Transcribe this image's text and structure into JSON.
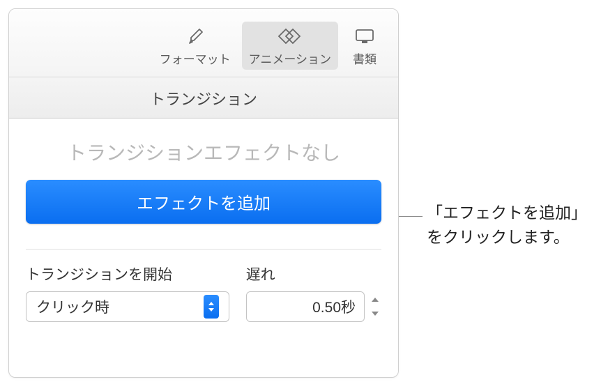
{
  "toolbar": {
    "format_label": "フォーマット",
    "animation_label": "アニメーション",
    "document_label": "書類"
  },
  "tab": {
    "transition_label": "トランジション"
  },
  "content": {
    "no_effect_text": "トランジションエフェクトなし",
    "add_effect_label": "エフェクトを追加"
  },
  "fields": {
    "trigger_label": "トランジションを開始",
    "trigger_value": "クリック時",
    "delay_label": "遅れ",
    "delay_value": "0.50秒"
  },
  "callout": {
    "line1": "「エフェクトを追加」",
    "line2": "をクリックします。"
  }
}
